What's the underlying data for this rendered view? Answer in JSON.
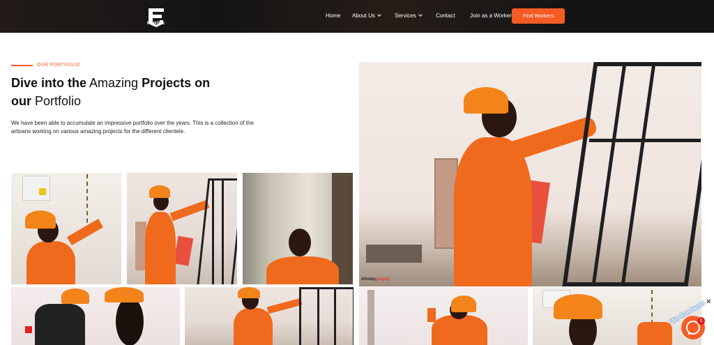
{
  "brand": {
    "name": "FUNDIS"
  },
  "nav": {
    "items": [
      {
        "label": "Home"
      },
      {
        "label": "About Us"
      },
      {
        "label": "Services"
      },
      {
        "label": "Contact"
      },
      {
        "label": "Join as a Worker"
      }
    ],
    "cta": "Find Workers"
  },
  "portfolio": {
    "eyebrow": "OUR PORTFOLIO",
    "headline_part1": "Dive into the",
    "headline_part2": "Amazing",
    "headline_part3": "Projects on",
    "headline_part4": "our",
    "headline_part5": "Portfolio",
    "description": "We have been able to accumulate an impressive portfolio over the years. This is a collection of the artisans working on various amazing projects for the different clientele."
  },
  "watermark": {
    "prefix": "Afromy",
    "suffix": "graphy"
  },
  "chat": {
    "badge_count": "1",
    "bubble_text": "We Are Here!"
  },
  "colors": {
    "accent": "#f45b25",
    "nav_bg": "#141414"
  }
}
